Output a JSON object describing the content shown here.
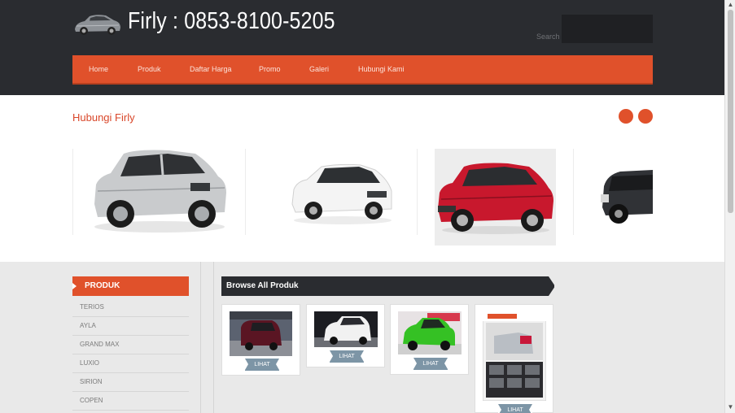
{
  "header": {
    "site_title": "Firly : 0853-8100-5205",
    "search_label": "Search",
    "search_value": ""
  },
  "nav": {
    "items": [
      "Home",
      "Produk",
      "Daftar Harga",
      "Promo",
      "Galeri",
      "Hubungi Kami"
    ]
  },
  "slider": {
    "title": "Hubungi Firly",
    "slides": [
      "silver-terios",
      "white-avanza",
      "red-terios",
      "black-ayla"
    ]
  },
  "sidebar": {
    "heading": "PRODUK",
    "items": [
      "TERIOS",
      "AYLA",
      "GRAND MAX",
      "LUXIO",
      "SIRION",
      "COPEN"
    ]
  },
  "main": {
    "heading": "Browse All Produk",
    "products": [
      {
        "image": "maroon-luxio",
        "button": "LIHAT"
      },
      {
        "image": "white-terios",
        "button": "LIHAT"
      },
      {
        "image": "green-ayla",
        "button": "LIHAT"
      },
      {
        "image": "grand-max-brochure",
        "button": "LIHAT"
      }
    ]
  },
  "colors": {
    "accent": "#e0512b",
    "header_bg": "#2a2c30",
    "button": "#7d95a6"
  }
}
